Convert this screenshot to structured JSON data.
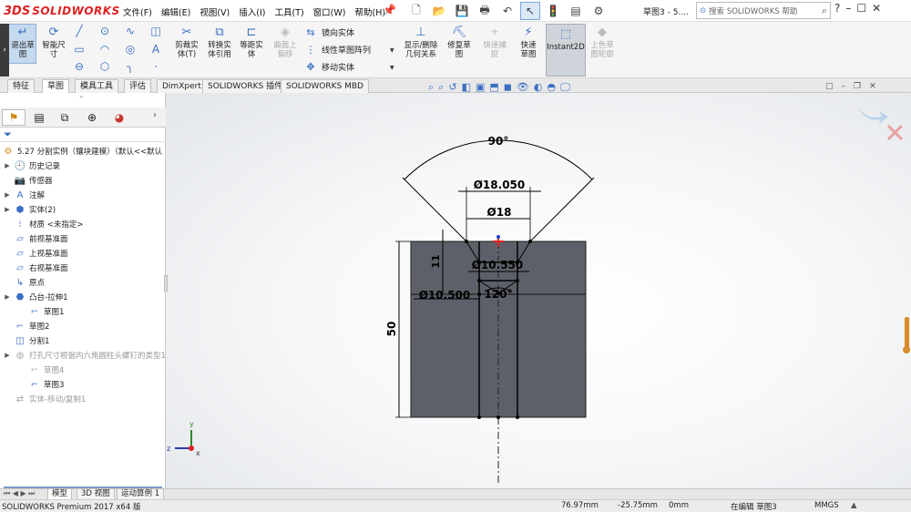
{
  "app": {
    "brand": "SOLIDWORKS",
    "brand_prefix": "3DS"
  },
  "menus": [
    "文件(F)",
    "编辑(E)",
    "视图(V)",
    "插入(I)",
    "工具(T)",
    "窗口(W)",
    "帮助(H)"
  ],
  "doc_title": "草图3 - 5....",
  "search": {
    "placeholder": "搜索 SOLIDWORKS 帮助"
  },
  "window_controls": [
    "?",
    "–",
    "☐",
    "✕"
  ],
  "toolbar": {
    "exit_sketch": "退出草图",
    "smart_dim": "智能尺寸",
    "trim": "剪裁实体(T)",
    "convert": "转换实体引用",
    "offset": "等距实体",
    "surface_offset": "曲面上偏移",
    "mirror": "镜向实体",
    "linear_pattern": "线性草图阵列",
    "move": "移动实体",
    "display_delete_relations": "显示/删除几何关系",
    "repair_sketch": "修复草图",
    "quick_snap": "快速捕捉",
    "rapid_sketch": "快速草图",
    "instant2d": "Instant2D",
    "shaded_contours": "上色草图轮廓"
  },
  "tabs": [
    "特征",
    "草图",
    "模具工具",
    "评估",
    "DimXpert",
    "SOLIDWORKS 插件",
    "SOLIDWORKS MBD"
  ],
  "active_tab": 1,
  "tree": {
    "root": "5.27 分割实例（镶块建模）（默认<<默认",
    "items": [
      {
        "label": "历史记录",
        "icon": "history-icon",
        "expand": true,
        "gray": false,
        "indent": 0
      },
      {
        "label": "传感器",
        "icon": "sensor-icon",
        "expand": false,
        "gray": false,
        "indent": 0
      },
      {
        "label": "注解",
        "icon": "annotation-icon",
        "expand": true,
        "gray": false,
        "indent": 0
      },
      {
        "label": "实体(2)",
        "icon": "solid-bodies-icon",
        "expand": true,
        "gray": false,
        "indent": 0
      },
      {
        "label": "材质 <未指定>",
        "icon": "material-icon",
        "expand": false,
        "gray": false,
        "indent": 0
      },
      {
        "label": "前视基准面",
        "icon": "plane-icon",
        "expand": false,
        "gray": false,
        "indent": 0
      },
      {
        "label": "上视基准面",
        "icon": "plane-icon",
        "expand": false,
        "gray": false,
        "indent": 0
      },
      {
        "label": "右视基准面",
        "icon": "plane-icon",
        "expand": false,
        "gray": false,
        "indent": 0
      },
      {
        "label": "原点",
        "icon": "origin-icon",
        "expand": false,
        "gray": false,
        "indent": 0
      },
      {
        "label": "凸台-拉伸1",
        "icon": "extrude-icon",
        "expand": true,
        "gray": false,
        "indent": 0
      },
      {
        "label": "草图1",
        "icon": "sketch-icon",
        "expand": false,
        "gray": false,
        "indent": 1
      },
      {
        "label": "草图2",
        "icon": "sketch-icon",
        "expand": false,
        "gray": false,
        "indent": 0
      },
      {
        "label": "分割1",
        "icon": "split-icon",
        "expand": false,
        "gray": false,
        "indent": 0
      },
      {
        "label": "打孔尺寸根据内六角圆柱头螺钉的类型1",
        "icon": "hole-wizard-icon",
        "expand": true,
        "gray": true,
        "indent": 0
      },
      {
        "label": "草图4",
        "icon": "sketch-icon",
        "expand": false,
        "gray": true,
        "indent": 1
      },
      {
        "label": "草图3",
        "icon": "sketch-icon",
        "expand": false,
        "gray": false,
        "indent": 1
      },
      {
        "label": "实体-移动/复制1",
        "icon": "move-body-icon",
        "expand": false,
        "gray": true,
        "indent": 0
      }
    ]
  },
  "bottom_tabs": [
    "模型",
    "3D 视图",
    "运动算例 1"
  ],
  "status": {
    "product": "SOLIDWORKS Premium 2017 x64 版",
    "x": "76.97mm",
    "y": "-25.75mm",
    "z": "0mm",
    "state": "在编辑 草图3",
    "units": "MMGS"
  },
  "drawing": {
    "dims": {
      "angle_top": "90°",
      "d1": "Ø18.050",
      "d2": "Ø18",
      "d3": "Ø10.550",
      "d4": "Ø10.500",
      "angle_mid": "120°",
      "h11": "11",
      "h50": "50"
    },
    "colors": {
      "block": "#5d6069",
      "line": "#000000",
      "origin": "#e02020"
    }
  },
  "axes": {
    "x": "x",
    "y": "y",
    "z": "z"
  }
}
